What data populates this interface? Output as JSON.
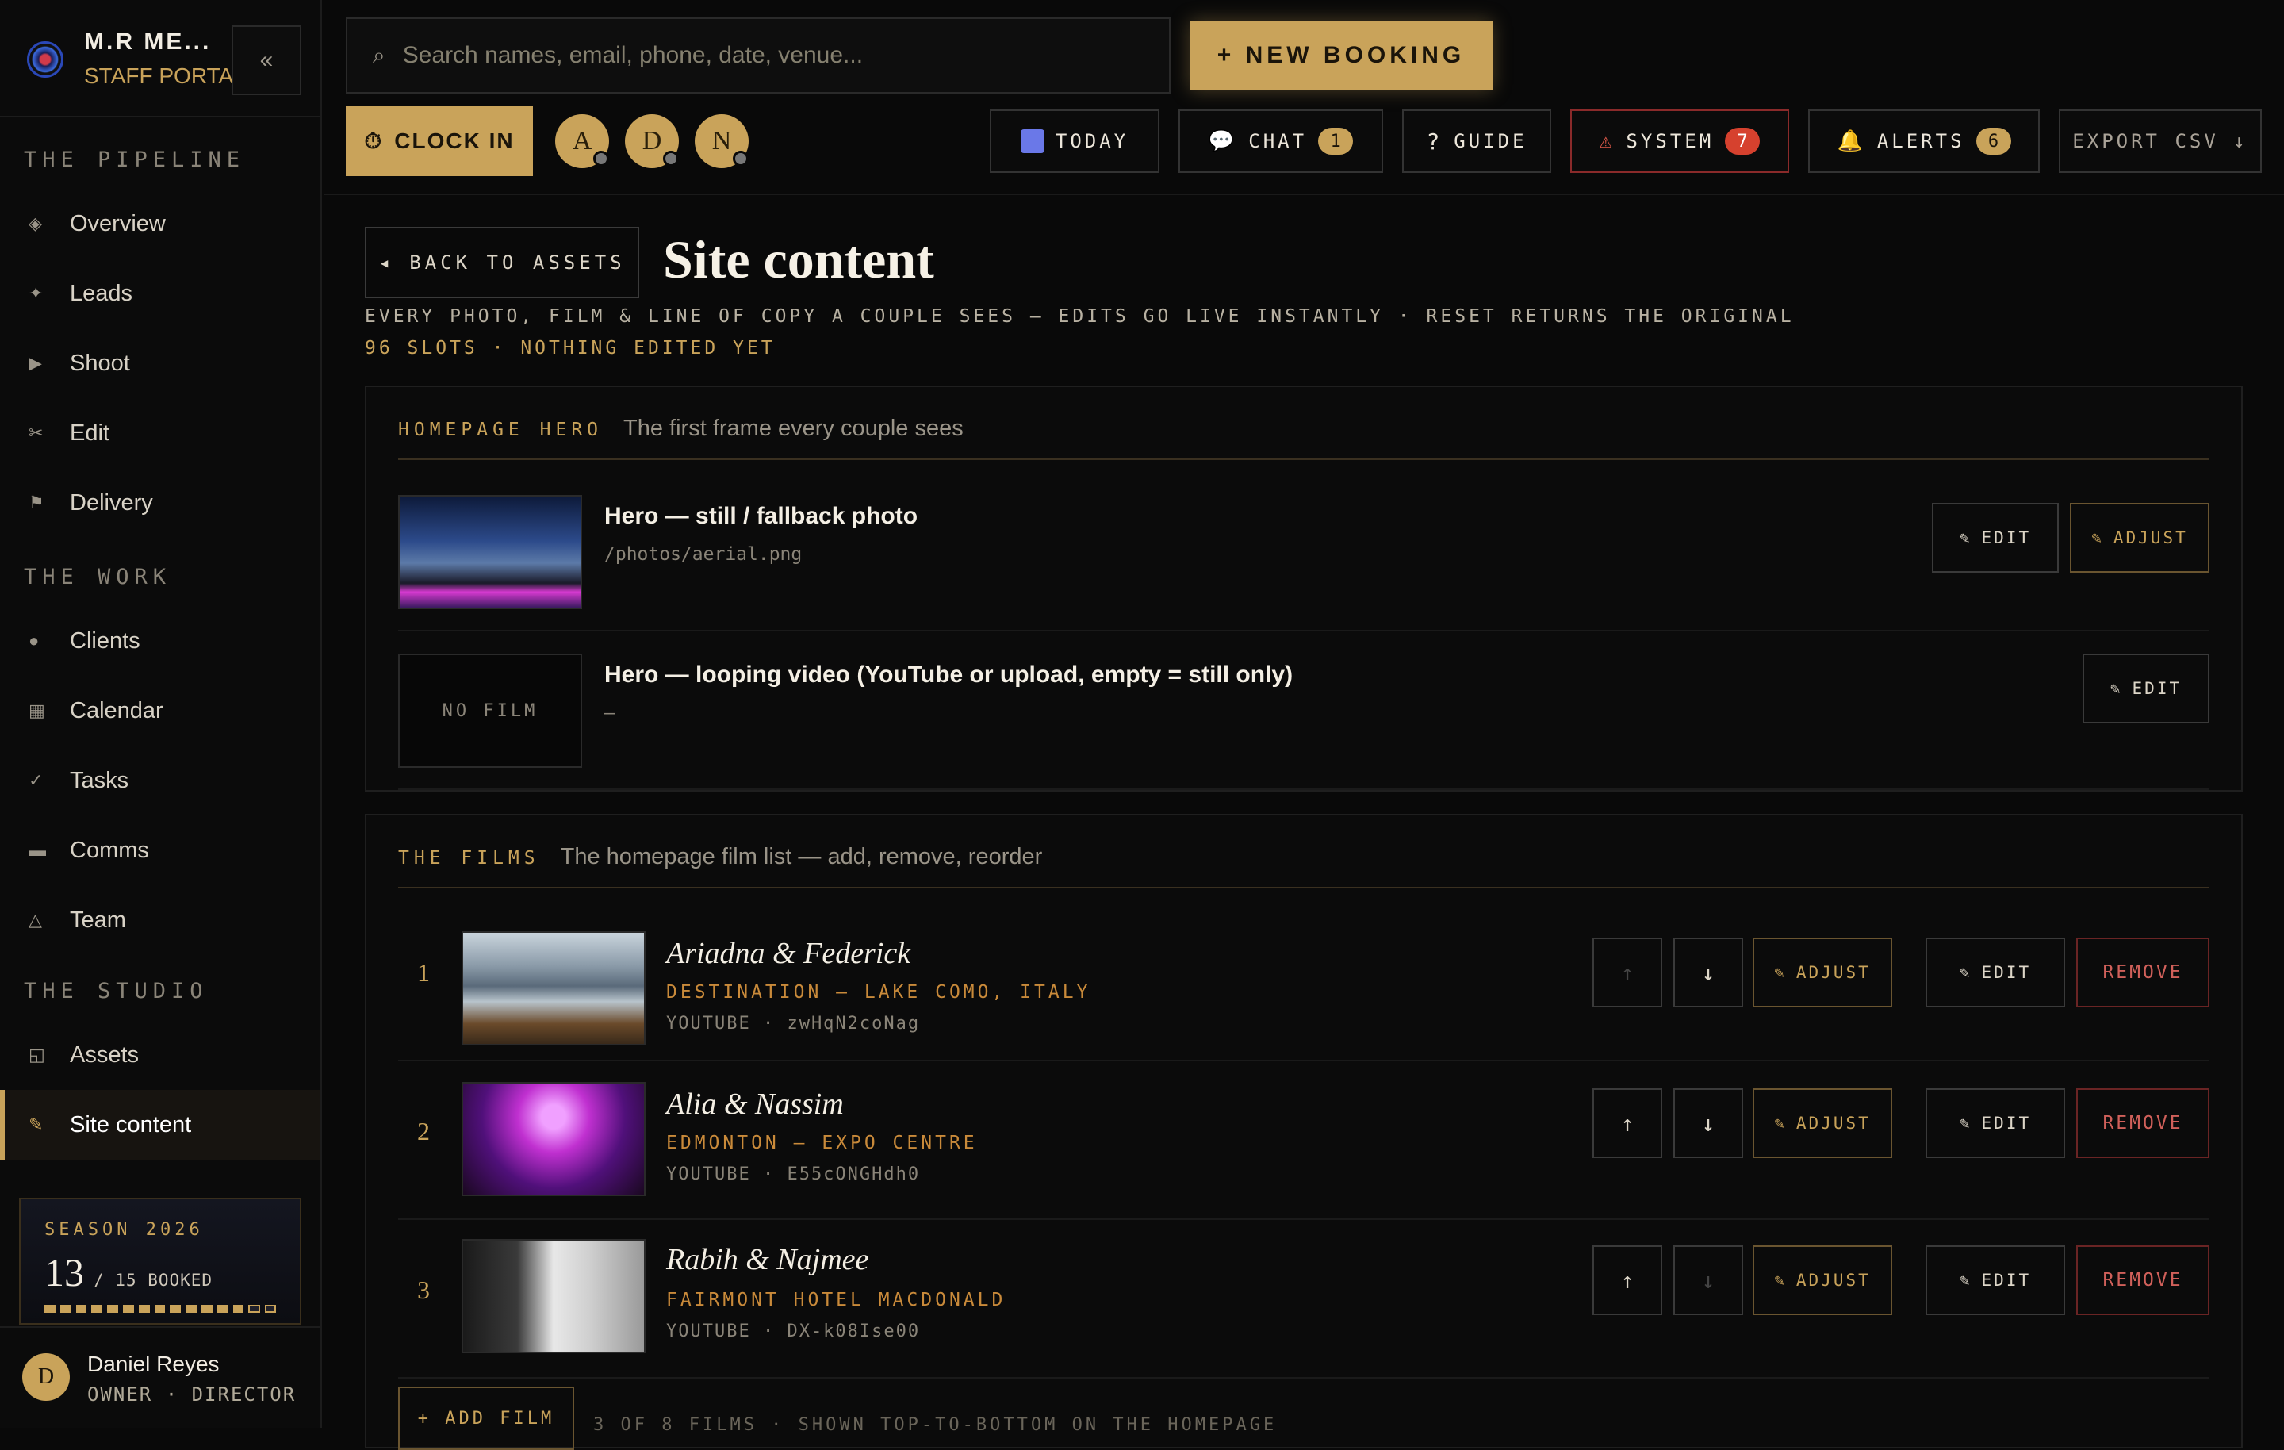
{
  "brand": {
    "name": "M.R ME...",
    "subtitle": "STAFF PORTAL",
    "collapse_icon": "«"
  },
  "sidebar": {
    "sections": [
      {
        "heading": "THE PIPELINE",
        "items": [
          {
            "icon": "◈",
            "label": "Overview"
          },
          {
            "icon": "✦",
            "label": "Leads"
          },
          {
            "icon": "▶",
            "label": "Shoot"
          },
          {
            "icon": "✂",
            "label": "Edit"
          },
          {
            "icon": "⚑",
            "label": "Delivery"
          }
        ]
      },
      {
        "heading": "THE WORK",
        "items": [
          {
            "icon": "●",
            "label": "Clients"
          },
          {
            "icon": "▦",
            "label": "Calendar"
          },
          {
            "icon": "✓",
            "label": "Tasks"
          },
          {
            "icon": "▬",
            "label": "Comms"
          },
          {
            "icon": "△",
            "label": "Team"
          }
        ]
      },
      {
        "heading": "THE STUDIO",
        "items": [
          {
            "icon": "◱",
            "label": "Assets"
          },
          {
            "icon": "✎",
            "label": "Site content",
            "active": true
          }
        ]
      }
    ],
    "season": {
      "label": "SEASON 2026",
      "booked": "13",
      "of": "/ 15 BOOKED",
      "booked_count": 13,
      "total": 15
    },
    "user": {
      "initial": "D",
      "name": "Daniel Reyes",
      "role": "OWNER · DIRECTOR"
    }
  },
  "topbar": {
    "search_placeholder": "Search names, email, phone, date, venue...",
    "search_icon": "⌕",
    "new_booking": "+ NEW BOOKING",
    "clock_in": "CLOCK IN",
    "clock_icon": "⏱",
    "people": [
      "A",
      "D",
      "N"
    ],
    "today": "TODAY",
    "chat": "CHAT",
    "chat_count": "1",
    "guide": "GUIDE",
    "system": "SYSTEM",
    "system_count": "7",
    "alerts": "ALERTS",
    "alerts_count": "6",
    "export": "EXPORT CSV ↓"
  },
  "page": {
    "back": "◂ BACK TO ASSETS",
    "title": "Site content",
    "description": "EVERY PHOTO, FILM & LINE OF COPY A COUPLE SEES — EDITS GO LIVE INSTANTLY · RESET RETURNS THE ORIGINAL",
    "slots": "96 SLOTS · NOTHING EDITED YET"
  },
  "hero": {
    "key": "HOMEPAGE HERO",
    "desc": "The first frame every couple sees",
    "rows": [
      {
        "title": "Hero — still / fallback photo",
        "path": "/photos/aerial.png",
        "edit": "EDIT",
        "adjust": "ADJUST"
      },
      {
        "title": "Hero — looping video (YouTube or upload, empty = still only)",
        "path": "—",
        "thumb_label": "NO FILM",
        "edit": "EDIT"
      }
    ]
  },
  "films": {
    "key": "THE FILMS",
    "desc": "The homepage film list — add, remove, reorder",
    "items": [
      {
        "num": "1",
        "name": "Ariadna & Federick",
        "location": "DESTINATION — LAKE COMO, ITALY",
        "source": "YOUTUBE · zwHqN2coNag"
      },
      {
        "num": "2",
        "name": "Alia & Nassim",
        "location": "EDMONTON — EXPO CENTRE",
        "source": "YOUTUBE · E55cONGHdh0"
      },
      {
        "num": "3",
        "name": "Rabih & Najmee",
        "location": "FAIRMONT HOTEL MACDONALD",
        "source": "YOUTUBE · DX-k08Ise00"
      }
    ],
    "adjust": "ADJUST",
    "edit": "EDIT",
    "remove": "REMOVE",
    "add": "+ ADD FILM",
    "note": "3 OF 8 FILMS · SHOWN TOP-TO-BOTTOM ON THE HOMEPAGE"
  }
}
